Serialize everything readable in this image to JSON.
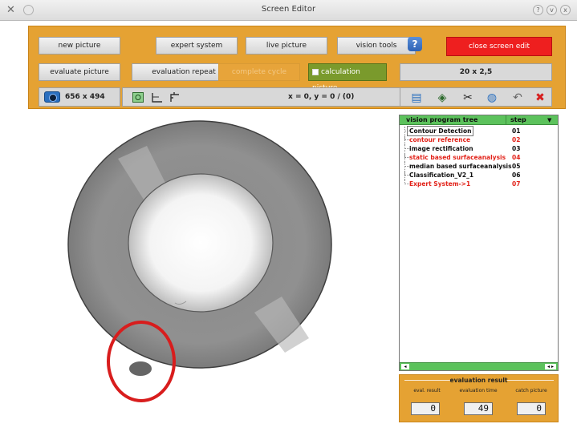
{
  "window": {
    "title": "Screen Editor",
    "wm_left_icon": "close-x-icon",
    "wm_buttons": [
      "?",
      "v",
      "x"
    ]
  },
  "toolbar": {
    "row1": {
      "new_picture": "new picture",
      "expert_system": "expert system",
      "live_picture": "live picture",
      "vision_tools": "vision tools",
      "help": "?",
      "close_screen_edit": "close screen edit"
    },
    "row2": {
      "evaluate_picture": "evaluate picture",
      "evaluation_repeat": "evaluation repeat",
      "complete_cycle": "complete cycle",
      "calculation_picture": "calculation picture",
      "size_value": "20 x 2,5"
    },
    "row3": {
      "resolution": "656 x 494",
      "coordinates": "x = 0, y = 0 / (0)"
    }
  },
  "colors": {
    "panel": "#e5a233",
    "close_button": "#ee1f1f",
    "calc_button": "#7a9a2c",
    "tree_header": "#5cc25c",
    "red_step": "#e2231a"
  },
  "tree": {
    "col_name": "vision program tree",
    "col_step": "step",
    "rows": [
      {
        "name": "Contour Detection",
        "step": "01",
        "color": "black"
      },
      {
        "name": "contour reference",
        "step": "02",
        "color": "red"
      },
      {
        "name": "image rectification",
        "step": "03",
        "color": "black"
      },
      {
        "name": "static based surfaceanalysis",
        "step": "04",
        "color": "red"
      },
      {
        "name": "median based surfaceanalysis",
        "step": "05",
        "color": "black"
      },
      {
        "name": "Classification_V2_1",
        "step": "06",
        "color": "black"
      },
      {
        "name": "Expert System->1",
        "step": "07",
        "color": "red"
      }
    ]
  },
  "evaluation": {
    "title": "evaluation result",
    "eval_result_label": "eval. result",
    "eval_time_label": "evaluation time",
    "catch_picture_label": "catch picture",
    "eval_result": "0",
    "eval_time": "49",
    "catch_picture": "0"
  }
}
